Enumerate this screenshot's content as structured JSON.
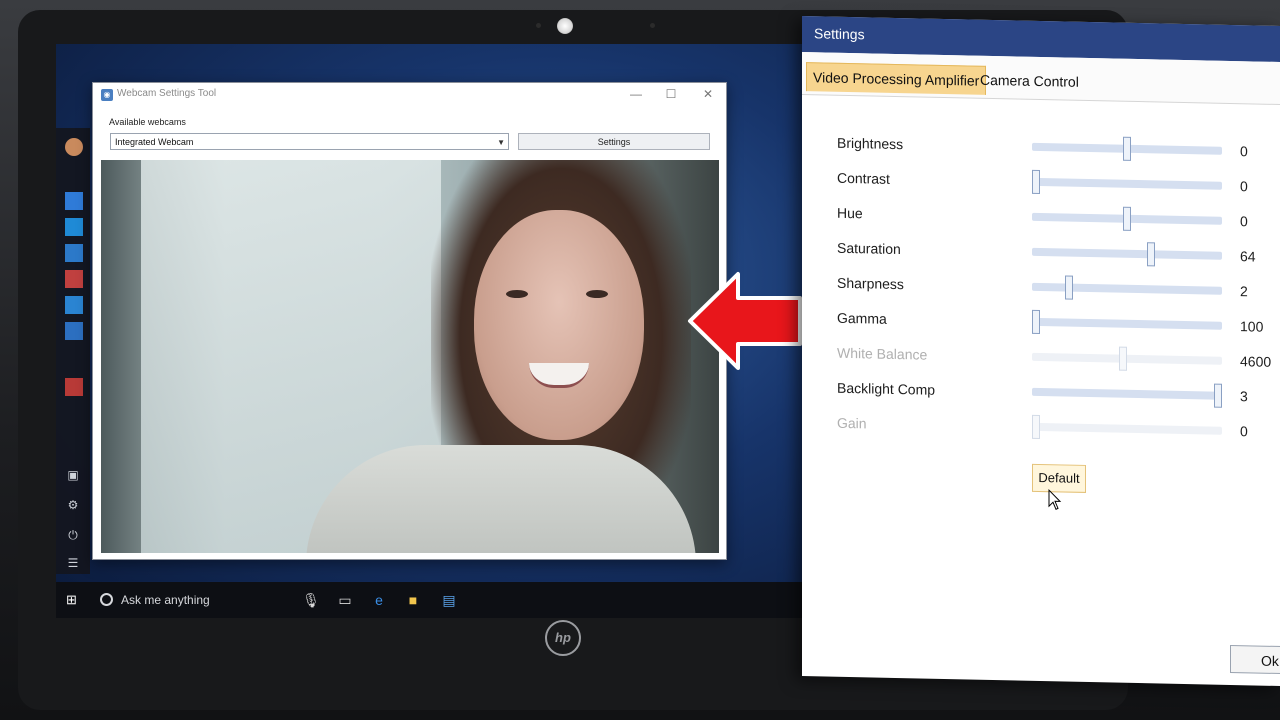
{
  "webcam_tool": {
    "title": "Webcam Settings Tool",
    "available_label": "Available webcams",
    "selected_webcam": "Integrated Webcam",
    "settings_button": "Settings"
  },
  "taskbar": {
    "search_text": "Ask me anything"
  },
  "laptop": {
    "brand": "hp"
  },
  "settings_dialog": {
    "title": "Settings",
    "tabs": [
      {
        "label": "Video Processing Amplifier",
        "active": true
      },
      {
        "label": "Camera Control",
        "active": false
      }
    ],
    "controls": [
      {
        "label": "Brightness",
        "value": "0",
        "level": 0.5,
        "enabled": true
      },
      {
        "label": "Contrast",
        "value": "0",
        "level": 0.0,
        "enabled": true
      },
      {
        "label": "Hue",
        "value": "0",
        "level": 0.5,
        "enabled": true
      },
      {
        "label": "Saturation",
        "value": "64",
        "level": 0.63,
        "enabled": true
      },
      {
        "label": "Sharpness",
        "value": "2",
        "level": 0.18,
        "enabled": true
      },
      {
        "label": "Gamma",
        "value": "100",
        "level": 0.0,
        "enabled": true
      },
      {
        "label": "White Balance",
        "value": "4600",
        "level": 0.48,
        "enabled": false
      },
      {
        "label": "Backlight Comp",
        "value": "3",
        "level": 1.0,
        "enabled": true
      },
      {
        "label": "Gain",
        "value": "0",
        "level": 0.0,
        "enabled": false
      }
    ],
    "default_button": "Default",
    "ok_button": "Ok"
  },
  "colors": {
    "settings_titlebar": "#2b4585",
    "active_tab": "#f7d58f",
    "arrow": "#e8161b"
  }
}
